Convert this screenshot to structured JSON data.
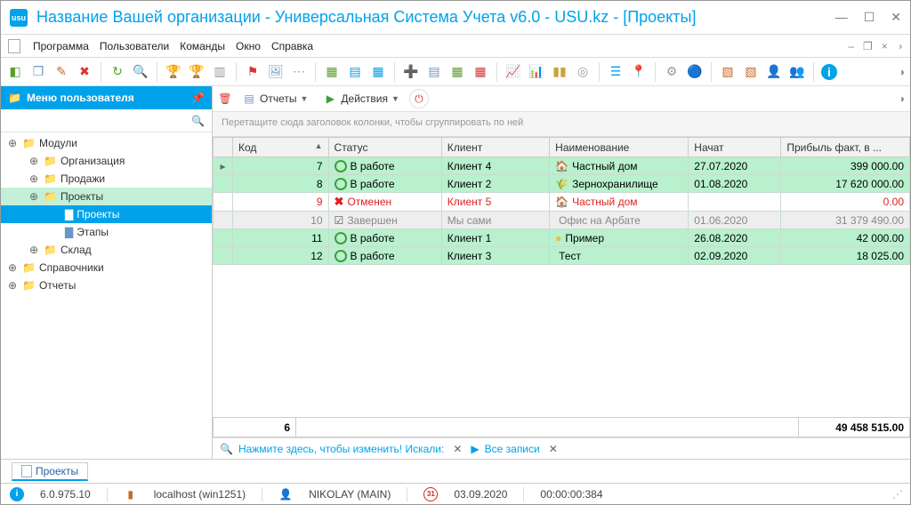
{
  "window": {
    "title": "Название Вашей организации - Универсальная Система Учета v6.0 - USU.kz - [Проекты]"
  },
  "menu": {
    "items": [
      "Программа",
      "Пользователи",
      "Команды",
      "Окно",
      "Справка"
    ]
  },
  "sidebar": {
    "title": "Меню пользователя",
    "tree": [
      {
        "label": "Модули",
        "depth": 0,
        "expandable": true
      },
      {
        "label": "Организация",
        "depth": 1,
        "expandable": true
      },
      {
        "label": "Продажи",
        "depth": 1,
        "expandable": true
      },
      {
        "label": "Проекты",
        "depth": 1,
        "expandable": true,
        "selParent": true
      },
      {
        "label": "Проекты",
        "depth": 2,
        "active": true
      },
      {
        "label": "Этапы",
        "depth": 2
      },
      {
        "label": "Склад",
        "depth": 1,
        "expandable": true
      },
      {
        "label": "Справочники",
        "depth": 0,
        "expandable": true
      },
      {
        "label": "Отчеты",
        "depth": 0,
        "expandable": true
      }
    ]
  },
  "contentToolbar": {
    "reports": "Отчеты",
    "actions": "Действия"
  },
  "groupHint": "Перетащите сюда заголовок колонки, чтобы сгруппировать по ней",
  "grid": {
    "columns": [
      "Код",
      "Статус",
      "Клиент",
      "Наименование",
      "Начат",
      "Прибыль факт, в ..."
    ],
    "rows": [
      {
        "code": "7",
        "status": "В работе",
        "statusType": "work",
        "client": "Клиент 4",
        "name": "Частный дом",
        "nameIcon": "🏠",
        "nameColor": "#d22",
        "date": "27.07.2020",
        "profit": "399 000.00",
        "cls": "green"
      },
      {
        "code": "8",
        "status": "В работе",
        "statusType": "work",
        "client": "Клиент 2",
        "name": "Зернохранилище",
        "nameIcon": "🌾",
        "nameColor": "#c73",
        "date": "01.08.2020",
        "profit": "17 620 000.00",
        "cls": "green"
      },
      {
        "code": "9",
        "status": "Отменен",
        "statusType": "cancel",
        "client": "Клиент 5",
        "name": "Частный дом",
        "nameIcon": "🏠",
        "nameColor": "#d22",
        "date": "",
        "profit": "0.00",
        "cls": "white",
        "red": true
      },
      {
        "code": "10",
        "status": "Завершен",
        "statusType": "done",
        "client": "Мы сами",
        "name": "Офис на Арбате",
        "nameIcon": "",
        "date": "01.06.2020",
        "profit": "31 379 490.00",
        "cls": "grey"
      },
      {
        "code": "11",
        "status": "В работе",
        "statusType": "work",
        "client": "Клиент 1",
        "name": "Пример",
        "nameIcon": "●",
        "nameColor": "#eac23a",
        "date": "26.08.2020",
        "profit": "42 000.00",
        "cls": "green"
      },
      {
        "code": "12",
        "status": "В работе",
        "statusType": "work",
        "client": "Клиент 3",
        "name": "Тест",
        "nameIcon": "",
        "date": "02.09.2020",
        "profit": "18 025.00",
        "cls": "green"
      }
    ],
    "totals": {
      "count": "6",
      "profit": "49 458 515.00"
    }
  },
  "filter": {
    "edit_hint": "Нажмите здесь, чтобы изменить! Искали:",
    "all_records": "Все записи"
  },
  "tab": {
    "label": "Проекты"
  },
  "status": {
    "version": "6.0.975.10",
    "server": "localhost (win1251)",
    "user": "NIKOLAY (MAIN)",
    "date": "03.09.2020",
    "time": "00:00:00:384"
  }
}
